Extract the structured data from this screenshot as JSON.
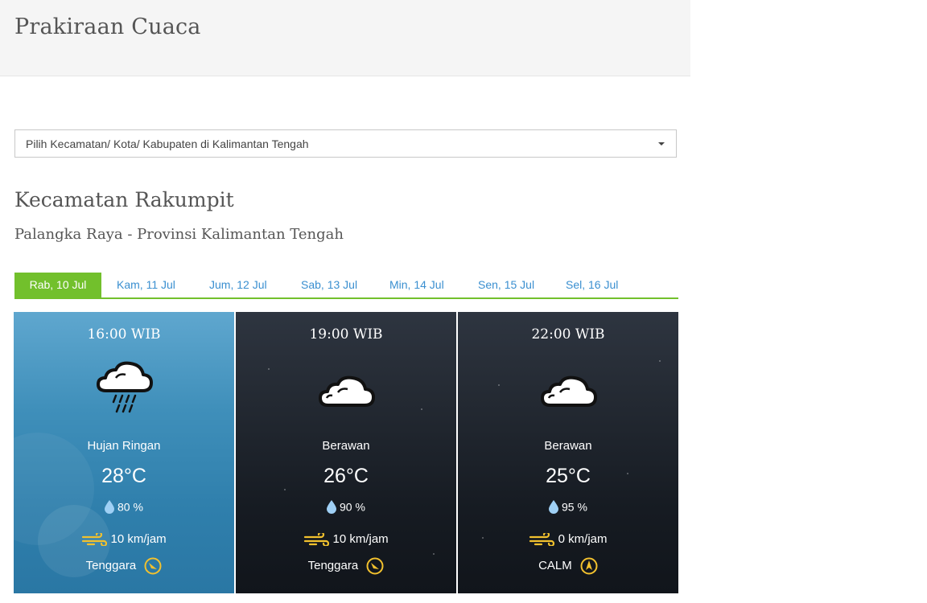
{
  "header": {
    "title": "Prakiraan Cuaca"
  },
  "location_select": {
    "label": "Pilih Kecamatan/ Kota/ Kabupaten di Kalimantan Tengah"
  },
  "location": {
    "title": "Kecamatan Rakumpit",
    "subtitle": "Palangka Raya - Provinsi Kalimantan Tengah"
  },
  "tabs": [
    {
      "label": "Rab, 10 Jul",
      "active": true
    },
    {
      "label": "Kam, 11 Jul"
    },
    {
      "label": "Jum, 12 Jul"
    },
    {
      "label": "Sab, 13 Jul"
    },
    {
      "label": "Min, 14 Jul"
    },
    {
      "label": "Sen, 15 Jul"
    },
    {
      "label": "Sel, 16 Jul"
    }
  ],
  "forecast": [
    {
      "time": "16:00 WIB",
      "condition": "Hujan Ringan",
      "icon": "cloud-rain-icon",
      "temp": "28°C",
      "humidity": "80 %",
      "wind_speed": "10 km/jam",
      "wind_dir": "Tenggara",
      "theme": "day"
    },
    {
      "time": "19:00 WIB",
      "condition": "Berawan",
      "icon": "cloud-icon",
      "temp": "26°C",
      "humidity": "90 %",
      "wind_speed": "10 km/jam",
      "wind_dir": "Tenggara",
      "theme": "night"
    },
    {
      "time": "22:00 WIB",
      "condition": "Berawan",
      "icon": "cloud-icon",
      "temp": "25°C",
      "humidity": "95 %",
      "wind_speed": "0 km/jam",
      "wind_dir": "CALM",
      "theme": "night"
    }
  ],
  "colors": {
    "accent": "#72c02c",
    "link": "#3a8fd0",
    "wind_icon": "#f2c12e",
    "drop": "#9fd0f5"
  }
}
